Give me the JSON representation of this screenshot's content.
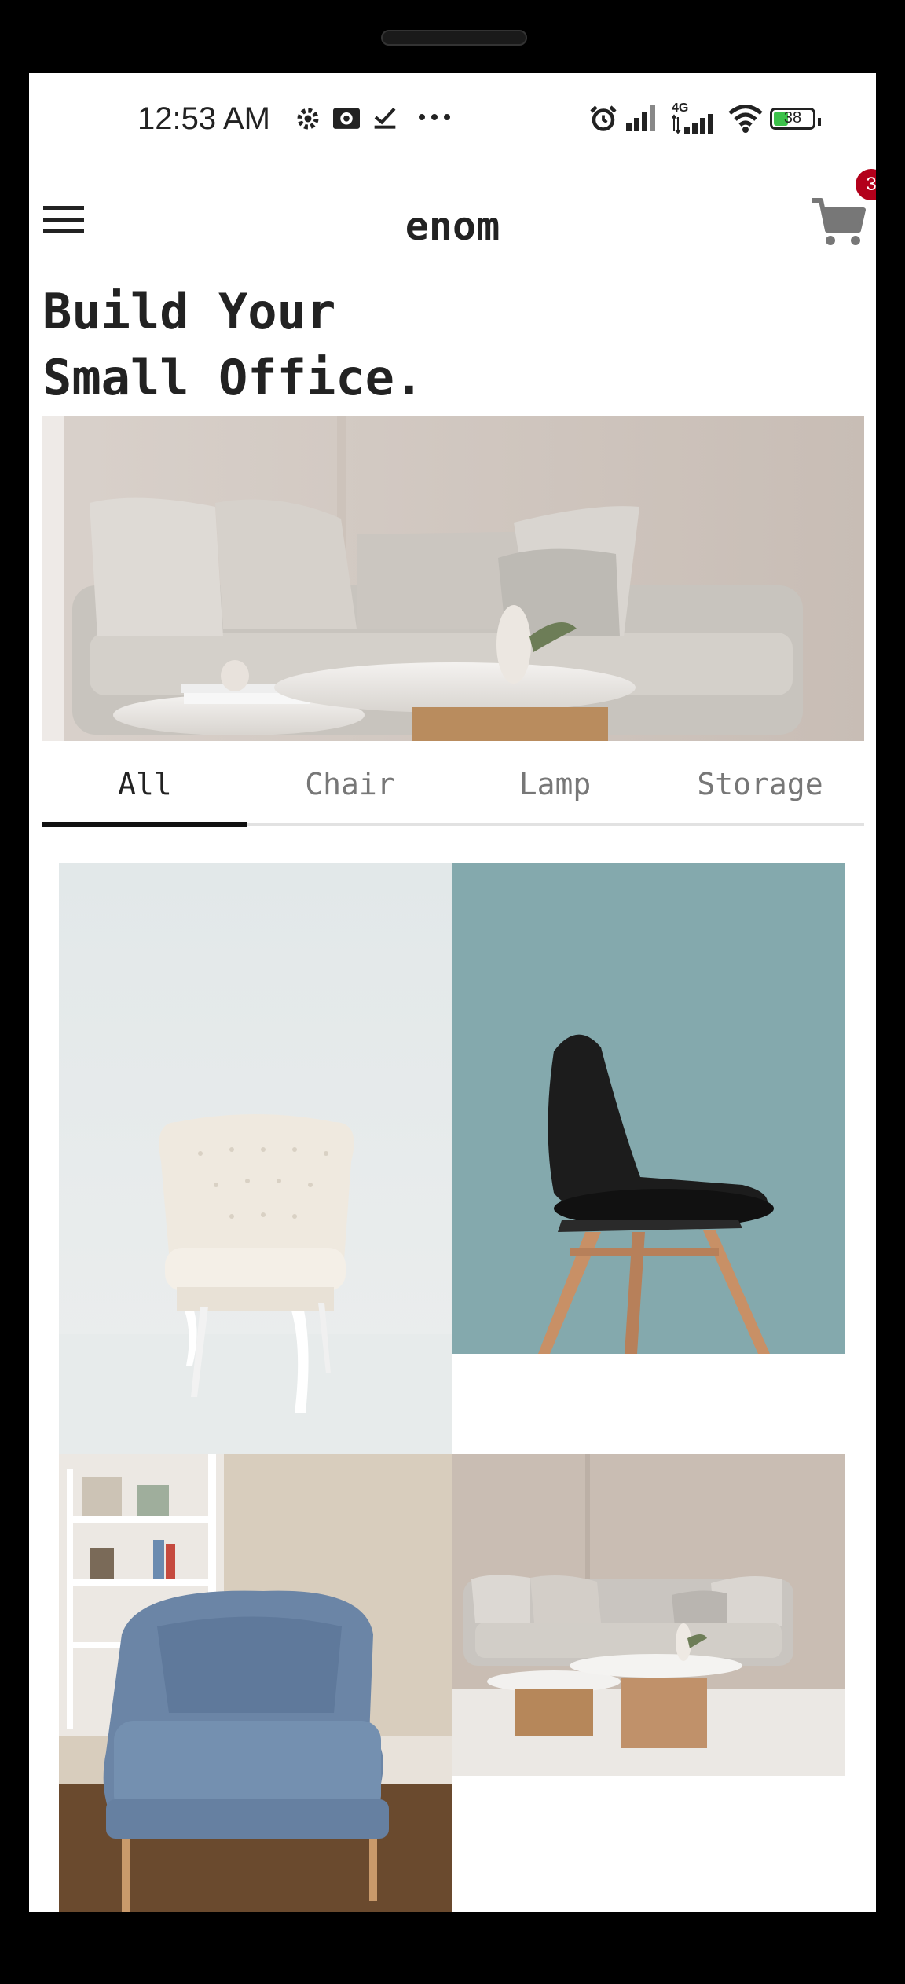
{
  "status_bar": {
    "time": "12:53 AM",
    "battery_level": "38",
    "network_label": "4G",
    "icons": [
      "gear-icon",
      "camera-icon",
      "check-icon",
      "more-icon",
      "alarm-icon",
      "signal-icon",
      "signal-4g-icon",
      "wifi-icon",
      "battery-icon"
    ]
  },
  "app_bar": {
    "brand": "enom",
    "cart_count": "3"
  },
  "headline": {
    "line1": "Build Your",
    "line2": "Small Office."
  },
  "tabs": [
    {
      "label": "All",
      "active": true
    },
    {
      "label": "Chair",
      "active": false
    },
    {
      "label": "Lamp",
      "active": false
    },
    {
      "label": "Storage",
      "active": false
    }
  ],
  "products": [
    {
      "name": "white-tufted-chair"
    },
    {
      "name": "black-scandi-chair"
    },
    {
      "name": "blue-armchair"
    },
    {
      "name": "living-room-sofa"
    }
  ],
  "colors": {
    "accent": "#111111",
    "badge": "#b3001b",
    "teal_bg": "#84a9ad",
    "wall": "#cfc5bd"
  }
}
